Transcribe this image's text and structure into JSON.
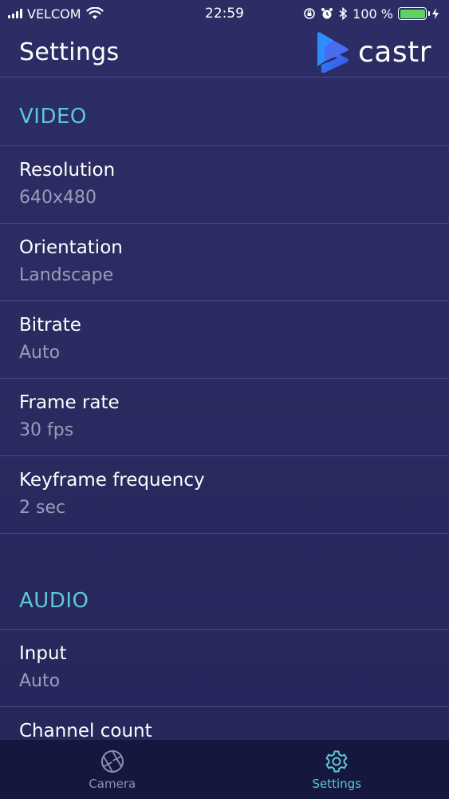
{
  "status_bar": {
    "carrier": "VELCOM",
    "time": "22:59",
    "battery": "100 %",
    "battery_level": 1.0
  },
  "header": {
    "title": "Settings",
    "brand_name": "castr"
  },
  "sections": {
    "video": {
      "title": "VIDEO",
      "rows": [
        {
          "label": "Resolution",
          "value": "640x480"
        },
        {
          "label": "Orientation",
          "value": "Landscape"
        },
        {
          "label": "Bitrate",
          "value": "Auto"
        },
        {
          "label": "Frame rate",
          "value": "30 fps"
        },
        {
          "label": "Keyframe frequency",
          "value": "2 sec"
        }
      ]
    },
    "audio": {
      "title": "AUDIO",
      "rows": [
        {
          "label": "Input",
          "value": "Auto"
        },
        {
          "label": "Channel count",
          "value": ""
        }
      ]
    }
  },
  "tab_bar": {
    "tabs": [
      {
        "label": "Camera",
        "icon": "aperture-icon",
        "active": false
      },
      {
        "label": "Settings",
        "icon": "gear-icon",
        "active": true
      }
    ]
  },
  "colors": {
    "background": "#2b2c62",
    "accent": "#5ec8d3",
    "secondary_text": "#9b9cb9",
    "tab_bar": "#15173e",
    "divider": "#474a86"
  }
}
